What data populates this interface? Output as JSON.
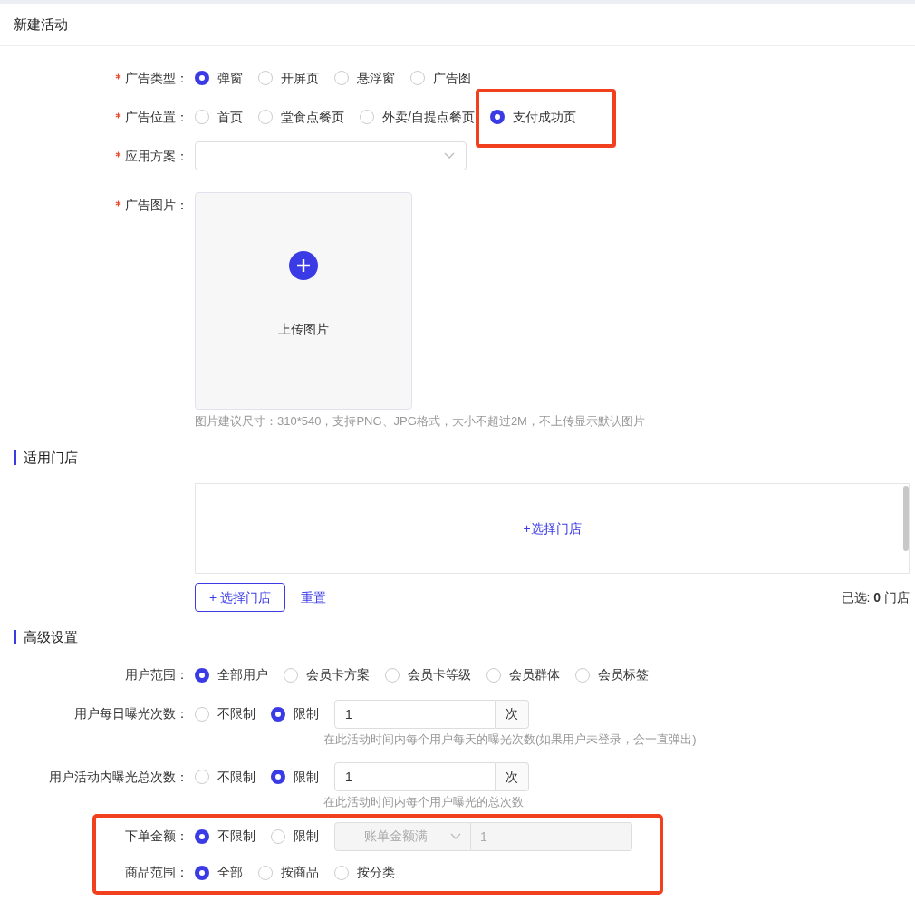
{
  "title": "新建活动",
  "ad_fields": [
    {
      "kind": "radio",
      "label": "广告类型：",
      "required": true,
      "options": [
        {
          "label": "弹窗",
          "selected": true,
          "highlighted": false
        },
        {
          "label": "开屏页",
          "selected": false,
          "highlighted": false
        },
        {
          "label": "悬浮窗",
          "selected": false,
          "highlighted": false
        },
        {
          "label": "广告图",
          "selected": false,
          "highlighted": false
        }
      ]
    },
    {
      "kind": "radio",
      "label": "广告位置：",
      "required": true,
      "options": [
        {
          "label": "首页",
          "selected": false,
          "highlighted": false
        },
        {
          "label": "堂食点餐页",
          "selected": false,
          "highlighted": false
        },
        {
          "label": "外卖/自提点餐页",
          "selected": false,
          "highlighted": false
        },
        {
          "label": "支付成功页",
          "selected": true,
          "highlighted": true
        }
      ]
    },
    {
      "kind": "select",
      "label": "应用方案：",
      "required": true
    },
    {
      "kind": "upload",
      "label": "广告图片：",
      "required": true,
      "upload_text": "上传图片",
      "hint": "图片建议尺寸：310*540，支持PNG、JPG格式，大小不超过2M，不上传显示默认图片"
    }
  ],
  "stores": {
    "heading": "适用门店",
    "empty_link": "+选择门店",
    "select_button": "+ 选择门店",
    "reset_link": "重置",
    "selected_label": "已选:",
    "selected_count": "0",
    "selected_unit": "门店"
  },
  "advanced": {
    "heading": "高级设置",
    "fields": [
      {
        "kind": "radio",
        "label": "用户范围：",
        "required": false,
        "highlighted": false,
        "options": [
          {
            "label": "全部用户",
            "selected": true
          },
          {
            "label": "会员卡方案",
            "selected": false
          },
          {
            "label": "会员卡等级",
            "selected": false
          },
          {
            "label": "会员群体",
            "selected": false
          },
          {
            "label": "会员标签",
            "selected": false
          }
        ]
      },
      {
        "kind": "limit",
        "label": "用户每日曝光次数：",
        "required": false,
        "highlighted": false,
        "options": [
          {
            "label": "不限制",
            "selected": false
          },
          {
            "label": "限制",
            "selected": true
          }
        ],
        "value": "1",
        "unit": "次",
        "hint": "在此活动时间内每个用户每天的曝光次数(如果用户未登录，会一直弹出)"
      },
      {
        "kind": "limit",
        "label": "用户活动内曝光总次数：",
        "required": false,
        "highlighted": false,
        "options": [
          {
            "label": "不限制",
            "selected": false
          },
          {
            "label": "限制",
            "selected": true
          }
        ],
        "value": "1",
        "unit": "次",
        "hint": "在此活动时间内每个用户曝光的总次数"
      },
      {
        "kind": "amount",
        "label": "下单金额：",
        "required": false,
        "highlighted": true,
        "disabled": true,
        "options": [
          {
            "label": "不限制",
            "selected": true
          },
          {
            "label": "限制",
            "selected": false
          }
        ],
        "select": "账单金额满",
        "value": "1"
      },
      {
        "kind": "radio",
        "label": "商品范围：",
        "required": false,
        "highlighted": true,
        "options": [
          {
            "label": "全部",
            "selected": true
          },
          {
            "label": "按商品",
            "selected": false
          },
          {
            "label": "按分类",
            "selected": false
          }
        ]
      }
    ]
  }
}
